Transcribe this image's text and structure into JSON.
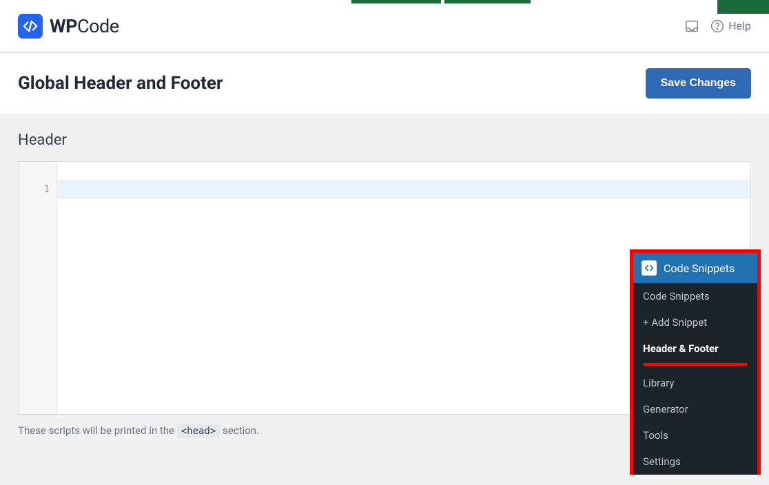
{
  "logo": {
    "brand_bold": "WP",
    "brand_light": "Code"
  },
  "top": {
    "help_label": "Help"
  },
  "page": {
    "title": "Global Header and Footer",
    "save_label": "Save Changes"
  },
  "section": {
    "heading": "Header"
  },
  "editor": {
    "line1": "1"
  },
  "hint": {
    "prefix": "These scripts will be printed in the ",
    "code": "<head>",
    "suffix": " section."
  },
  "menu": {
    "title": "Code Snippets",
    "items": {
      "snippets": "Code Snippets",
      "add": "+ Add Snippet",
      "header_footer": "Header & Footer",
      "library": "Library",
      "generator": "Generator",
      "tools": "Tools",
      "settings": "Settings"
    }
  }
}
